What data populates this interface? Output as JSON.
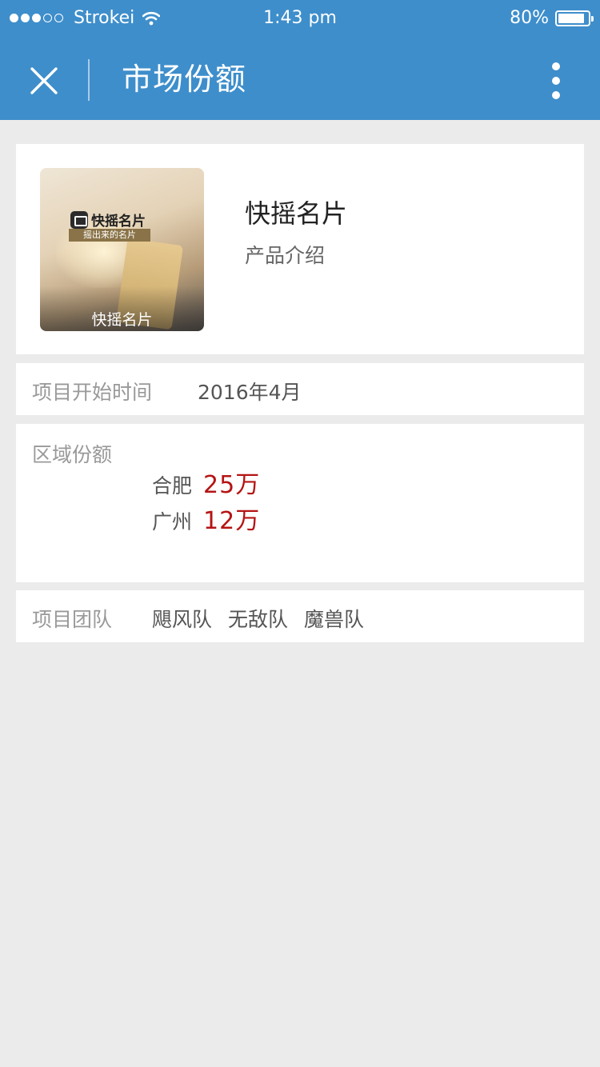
{
  "status_bar": {
    "carrier": "Strokei",
    "time": "1:43 pm",
    "battery": "80%",
    "signal_bars": 3,
    "signal_total": 5
  },
  "nav": {
    "title": "市场份额",
    "close_icon": "close-icon",
    "more_icon": "more-vertical-icon"
  },
  "product": {
    "name": "快摇名片",
    "link_label": "产品介绍",
    "thumbnail": {
      "logo_text": "快摇名片",
      "slogan": "摇出来的名片",
      "caption": "快摇名片"
    }
  },
  "start_time": {
    "label": "项目开始时间",
    "value": "2016年4月"
  },
  "regions": {
    "label": "区域份额",
    "items": [
      {
        "city": "合肥",
        "amount": "25万"
      },
      {
        "city": "广州",
        "amount": "12万"
      }
    ]
  },
  "team": {
    "label": "项目团队",
    "members": [
      "飓风队",
      "无敌队",
      "魔兽队"
    ]
  },
  "colors": {
    "header_bg": "#3e8ecb",
    "page_bg": "#ebebeb",
    "amount": "#b51414"
  }
}
